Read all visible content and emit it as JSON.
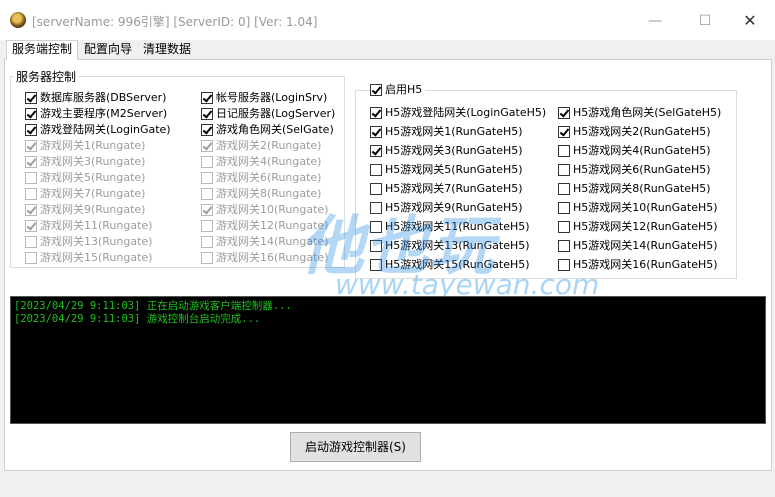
{
  "window": {
    "title": "[serverName: 996引擎] [ServerID: 0] [Ver: 1.04]",
    "controls": {
      "minimize": "—",
      "maximize": "☐",
      "close": "✕"
    }
  },
  "tabs": [
    {
      "label": "服务端控制",
      "active": true
    },
    {
      "label": "配置向导",
      "active": false
    },
    {
      "label": "清理数据",
      "active": false
    }
  ],
  "server_group": {
    "title": "服务器控制",
    "left_col": [
      {
        "label": "数据库服务器(DBServer)",
        "checked": true,
        "enabled": true
      },
      {
        "label": "游戏主要程序(M2Server)",
        "checked": true,
        "enabled": true
      },
      {
        "label": "游戏登陆网关(LoginGate)",
        "checked": true,
        "enabled": true
      },
      {
        "label": "游戏网关1(Rungate)",
        "checked": true,
        "enabled": false
      },
      {
        "label": "游戏网关3(Rungate)",
        "checked": true,
        "enabled": false
      },
      {
        "label": "游戏网关5(Rungate)",
        "checked": false,
        "enabled": false
      },
      {
        "label": "游戏网关7(Rungate)",
        "checked": false,
        "enabled": false
      },
      {
        "label": "游戏网关9(Rungate)",
        "checked": true,
        "enabled": false
      },
      {
        "label": "游戏网关11(Rungate)",
        "checked": true,
        "enabled": false
      },
      {
        "label": "游戏网关13(Rungate)",
        "checked": false,
        "enabled": false
      },
      {
        "label": "游戏网关15(Rungate)",
        "checked": false,
        "enabled": false
      }
    ],
    "right_col": [
      {
        "label": "帐号服务器(LoginSrv)",
        "checked": true,
        "enabled": true
      },
      {
        "label": "日记服务器(LogServer)",
        "checked": true,
        "enabled": true
      },
      {
        "label": "游戏角色网关(SelGate)",
        "checked": true,
        "enabled": true
      },
      {
        "label": "游戏网关2(Rungate)",
        "checked": true,
        "enabled": false
      },
      {
        "label": "游戏网关4(Rungate)",
        "checked": false,
        "enabled": false
      },
      {
        "label": "游戏网关6(Rungate)",
        "checked": false,
        "enabled": false
      },
      {
        "label": "游戏网关8(Rungate)",
        "checked": false,
        "enabled": false
      },
      {
        "label": "游戏网关10(Rungate)",
        "checked": true,
        "enabled": false
      },
      {
        "label": "游戏网关12(Rungate)",
        "checked": false,
        "enabled": false
      },
      {
        "label": "游戏网关14(Rungate)",
        "checked": false,
        "enabled": false
      },
      {
        "label": "游戏网关16(Rungate)",
        "checked": false,
        "enabled": false
      }
    ]
  },
  "h5_group": {
    "enable_label": "启用H5",
    "enable_checked": true,
    "left_col": [
      {
        "label": "H5游戏登陆网关(LoginGateH5)",
        "checked": true
      },
      {
        "label": "H5游戏网关1(RunGateH5)",
        "checked": true
      },
      {
        "label": "H5游戏网关3(RunGateH5)",
        "checked": true
      },
      {
        "label": "H5游戏网关5(RunGateH5)",
        "checked": false
      },
      {
        "label": "H5游戏网关7(RunGateH5)",
        "checked": false
      },
      {
        "label": "H5游戏网关9(RunGateH5)",
        "checked": false
      },
      {
        "label": "H5游戏网关11(RunGateH5)",
        "checked": false
      },
      {
        "label": "H5游戏网关13(RunGateH5)",
        "checked": false
      },
      {
        "label": "H5游戏网关15(RunGateH5)",
        "checked": false
      }
    ],
    "right_col": [
      {
        "label": "H5游戏角色网关(SelGateH5)",
        "checked": true
      },
      {
        "label": "H5游戏网关2(RunGateH5)",
        "checked": true
      },
      {
        "label": "H5游戏网关4(RunGateH5)",
        "checked": false
      },
      {
        "label": "H5游戏网关6(RunGateH5)",
        "checked": false
      },
      {
        "label": "H5游戏网关8(RunGateH5)",
        "checked": false
      },
      {
        "label": "H5游戏网关10(RunGateH5)",
        "checked": false
      },
      {
        "label": "H5游戏网关12(RunGateH5)",
        "checked": false
      },
      {
        "label": "H5游戏网关14(RunGateH5)",
        "checked": false
      },
      {
        "label": "H5游戏网关16(RunGateH5)",
        "checked": false
      }
    ]
  },
  "console": {
    "lines": [
      "[2023/04/29 9:11:03] 正在启动游戏客户端控制器...",
      "[2023/04/29 9:11:03] 游戏控制台启动完成..."
    ]
  },
  "start_button": {
    "label": "启动游戏控制器(S)"
  },
  "watermark": {
    "logo": "他也玩",
    "url": "www.tayewan.com"
  },
  "colors": {
    "console_bg": "#000000",
    "console_text": "#20c020",
    "watermark": "#288ce6"
  }
}
